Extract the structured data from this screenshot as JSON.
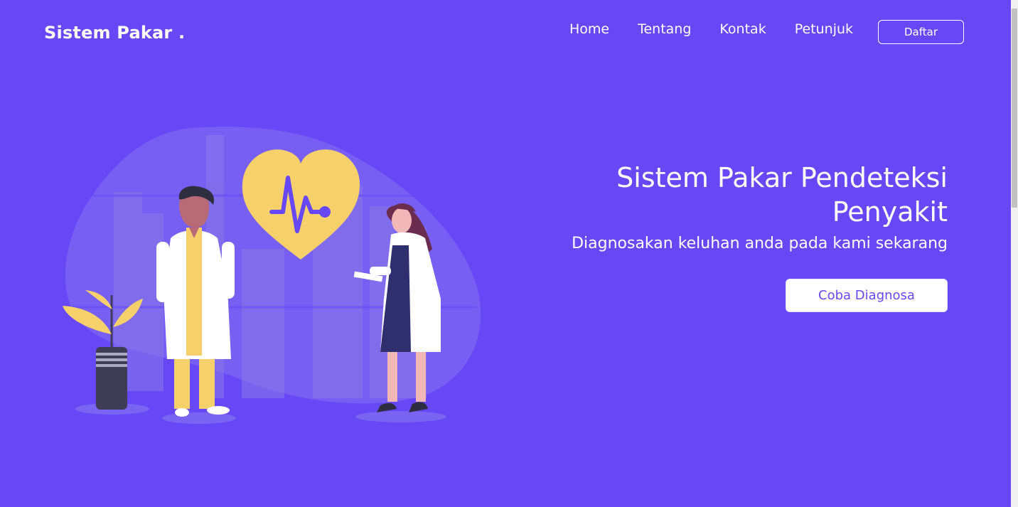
{
  "header": {
    "brand": "Sistem Pakar .",
    "nav": [
      "Home",
      "Tentang",
      "Kontak",
      "Petunjuk"
    ],
    "cta": "Daftar"
  },
  "hero": {
    "title_line1": "Sistem Pakar Pendeteksi",
    "title_line2": "Penyakit",
    "subtitle": "Diagnosakan keluhan anda pada kami sekarang",
    "button": "Coba Diagnosa"
  },
  "colors": {
    "background": "#6648f6",
    "accent_yellow": "#f5d06b",
    "white": "#ffffff"
  },
  "illustration": {
    "icons": [
      "heart-icon",
      "heartbeat-line-icon",
      "doctor-male-figure",
      "doctor-female-figure",
      "plant-icon"
    ]
  }
}
